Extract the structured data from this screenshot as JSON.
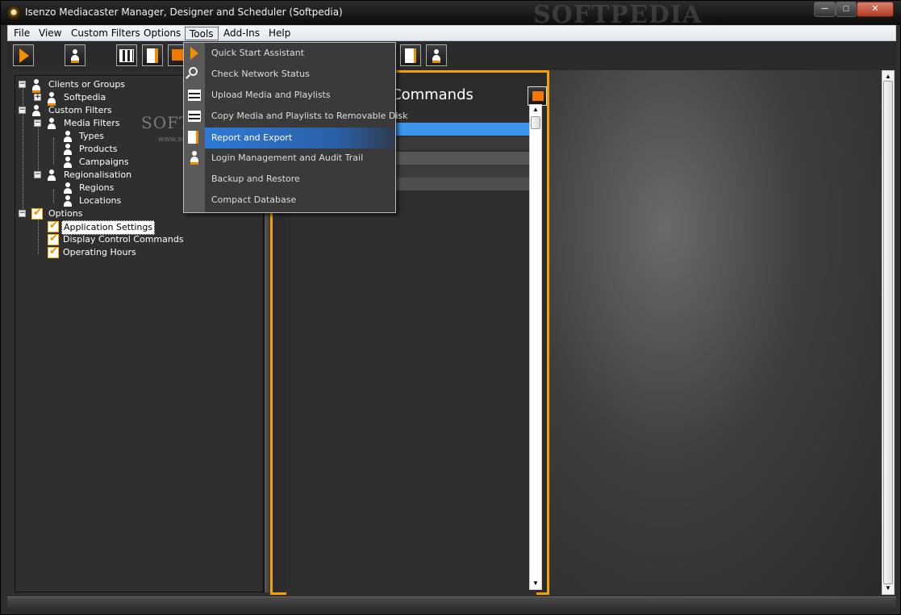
{
  "window": {
    "title": "Isenzo Mediacaster Manager, Designer and Scheduler (Softpedia)",
    "watermark": "SOFTPEDIA",
    "minimize": "─",
    "maximize": "□",
    "close": "✕"
  },
  "menubar": {
    "items": [
      "File",
      "View",
      "Custom Filters",
      "Options",
      "Tools",
      "Add-Ins",
      "Help"
    ],
    "active": "Tools"
  },
  "tree": {
    "nodes": [
      {
        "label": "Clients or Groups",
        "icon": "person-icon"
      },
      {
        "label": "Softpedia",
        "icon": "person-icon"
      },
      {
        "label": "Custom Filters",
        "icon": "person-icon"
      },
      {
        "label": "Media Filters",
        "icon": "person-icon"
      },
      {
        "label": "Types",
        "icon": "person-icon"
      },
      {
        "label": "Products",
        "icon": "person-icon"
      },
      {
        "label": "Campaigns",
        "icon": "person-icon"
      },
      {
        "label": "Regionalisation",
        "icon": "person-icon"
      },
      {
        "label": "Regions",
        "icon": "person-icon"
      },
      {
        "label": "Locations",
        "icon": "person-icon"
      },
      {
        "label": "Options",
        "icon": "check-icon"
      },
      {
        "label": "Application Settings",
        "icon": "check-icon",
        "selected": true
      },
      {
        "label": "Display Control Commands",
        "icon": "check-icon"
      },
      {
        "label": "Operating Hours",
        "icon": "check-icon"
      }
    ]
  },
  "mid_panel": {
    "title": "Commands"
  },
  "tools_menu": {
    "items": [
      {
        "label": "Quick Start Assistant",
        "icon": "play-icon"
      },
      {
        "label": "Check Network Status",
        "icon": "search-icon"
      },
      {
        "label": "Upload Media and Playlists",
        "icon": "film-icon"
      },
      {
        "label": "Copy Media and Playlists to Removable Disk",
        "icon": "film-icon"
      },
      {
        "label": "Report and Export",
        "icon": "document-icon",
        "highlighted": true
      },
      {
        "label": "Login Management and Audit Trail",
        "icon": "user-icon"
      },
      {
        "label": "Backup and Restore",
        "icon": ""
      },
      {
        "label": "Compact Database",
        "icon": ""
      }
    ]
  },
  "watermark_center": "SOFTPEDIA",
  "watermark_url": "www.softpedia.com",
  "colors": {
    "accent": "#f4a000",
    "highlight": "#2f7ad8",
    "list_selected": "#3c95ec"
  }
}
